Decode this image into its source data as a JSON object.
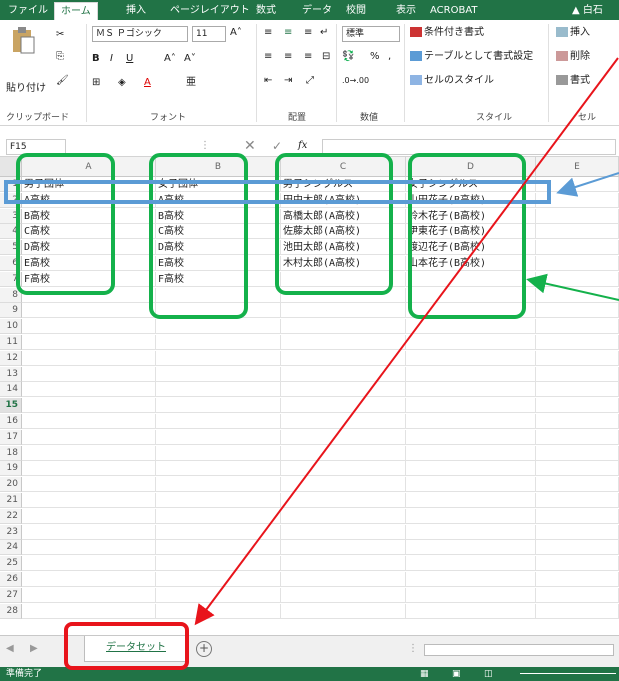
{
  "ribbon_tabs": [
    "ファイル",
    "ホーム",
    "挿入",
    "ページレイアウト",
    "数式",
    "データ",
    "校閲",
    "表示",
    "ACROBAT"
  ],
  "user_name": "▲ 白石",
  "clipboard": {
    "paste": "貼り付け",
    "group_label": "クリップボード"
  },
  "font": {
    "name": "ＭＳ Ｐゴシック",
    "size": "11",
    "group_label": "フォント"
  },
  "alignment": {
    "group_label": "配置"
  },
  "number": {
    "format": "標準",
    "percent": "%",
    "group_label": "数値"
  },
  "styles": {
    "conditional": "条件付き書式",
    "as_table": "テーブルとして書式設定",
    "cell_styles": "セルのスタイル",
    "group_label": "スタイル"
  },
  "cells_group": {
    "insert": "挿入",
    "delete": "削除",
    "format": "書式",
    "group_label": "セル"
  },
  "name_box": "F15",
  "columns": [
    "A",
    "B",
    "C",
    "D",
    "E"
  ],
  "rows": [
    [
      "男子団体",
      "女子団体",
      "男子シングルス",
      "女子シングルス"
    ],
    [
      "A高校",
      "A高校",
      "田中太郎(A高校)",
      "山田花子(B高校)"
    ],
    [
      "B高校",
      "B高校",
      "高橋太郎(A高校)",
      "鈴木花子(B高校)"
    ],
    [
      "C高校",
      "C高校",
      "佐藤太郎(A高校)",
      "伊東花子(B高校)"
    ],
    [
      "D高校",
      "D高校",
      "池田太郎(A高校)",
      "渡辺花子(B高校)"
    ],
    [
      "E高校",
      "E高校",
      "木村太郎(A高校)",
      "山本花子(B高校)"
    ],
    [
      "F高校",
      "F高校",
      "",
      ""
    ]
  ],
  "row_numbers": [
    "1",
    "2",
    "3",
    "4",
    "5",
    "6",
    "7",
    "8",
    "9",
    "10",
    "11",
    "12",
    "13",
    "14",
    "15",
    "16",
    "17",
    "18",
    "19",
    "20",
    "21",
    "22",
    "23",
    "24",
    "25",
    "26",
    "27",
    "28"
  ],
  "sheet_tab": "データセット",
  "add_sheet": "+",
  "status": "準備完了",
  "colors": {
    "excel_green": "#217346",
    "annotation_green": "#14b14b",
    "annotation_blue": "#5b9bd5",
    "annotation_red": "#e8141b"
  }
}
